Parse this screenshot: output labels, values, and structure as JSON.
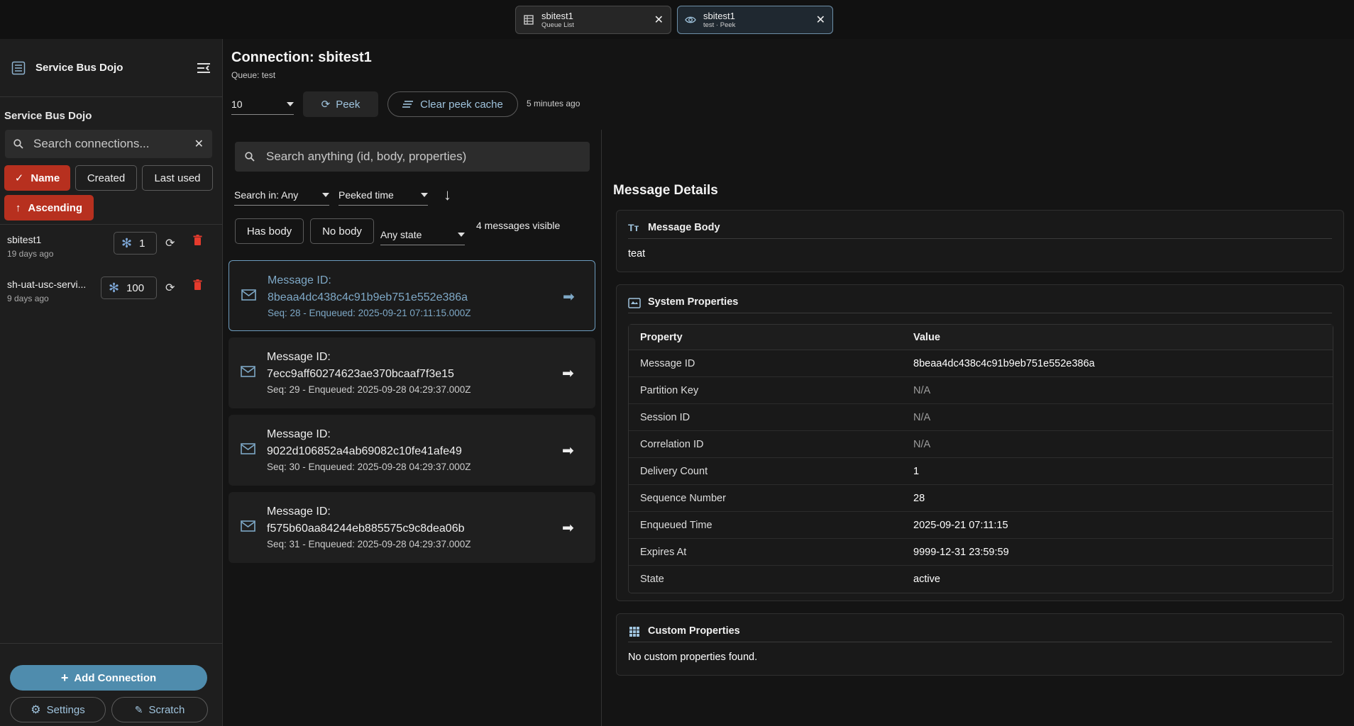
{
  "tabs": [
    {
      "name": "sbitest1",
      "sub": "Queue List",
      "icon": "table-icon",
      "active": false
    },
    {
      "name": "sbitest1",
      "sub": "test · Peek",
      "icon": "eye-icon",
      "active": true
    }
  ],
  "sidebar": {
    "brand": "Service Bus Dojo",
    "section_title": "Service Bus Dojo",
    "search_placeholder": "Search connections...",
    "sort_chips": {
      "name": "Name",
      "created": "Created",
      "last_used": "Last used",
      "order": "Ascending"
    },
    "connections": [
      {
        "name": "sbitest1",
        "sub": "19 days ago",
        "count": "1"
      },
      {
        "name": "sh-uat-usc-servi...",
        "sub": "9 days ago",
        "count": "100"
      }
    ],
    "footer": {
      "add": "Add Connection",
      "settings": "Settings",
      "scratch": "Scratch"
    }
  },
  "main": {
    "title": "Connection: sbitest1",
    "subtitle": "Queue: test",
    "peek_count": "10",
    "peek_label": "Peek",
    "clear_label": "Clear peek cache",
    "updated": "5 minutes ago",
    "search_placeholder": "Search anything (id, body, properties)",
    "search_in": "Search in: Any",
    "sort_by": "Peeked time",
    "filters": {
      "has_body": "Has body",
      "no_body": "No body",
      "state": "Any state"
    },
    "visible_count": "4 messages visible",
    "messages": [
      {
        "label": "Message ID:",
        "id": "8beaa4dc438c4c91b9eb751e552e386a",
        "meta": "Seq: 28 - Enqueued: 2025-09-21 07:11:15.000Z"
      },
      {
        "label": "Message ID:",
        "id": "7ecc9aff60274623ae370bcaaf7f3e15",
        "meta": "Seq: 29 - Enqueued: 2025-09-28 04:29:37.000Z"
      },
      {
        "label": "Message ID:",
        "id": "9022d106852a4ab69082c10fe41afe49",
        "meta": "Seq: 30 - Enqueued: 2025-09-28 04:29:37.000Z"
      },
      {
        "label": "Message ID:",
        "id": "f575b60aa84244eb885575c9c8dea06b",
        "meta": "Seq: 31 - Enqueued: 2025-09-28 04:29:37.000Z"
      }
    ]
  },
  "details": {
    "title": "Message Details",
    "body_title": "Message Body",
    "body": "teat",
    "sys_title": "System Properties",
    "col_property": "Property",
    "col_value": "Value",
    "props": [
      {
        "k": "Message ID",
        "v": "8beaa4dc438c4c91b9eb751e552e386a"
      },
      {
        "k": "Partition Key",
        "v": "N/A"
      },
      {
        "k": "Session ID",
        "v": "N/A"
      },
      {
        "k": "Correlation ID",
        "v": "N/A"
      },
      {
        "k": "Delivery Count",
        "v": "1"
      },
      {
        "k": "Sequence Number",
        "v": "28"
      },
      {
        "k": "Enqueued Time",
        "v": "2025-09-21 07:11:15"
      },
      {
        "k": "Expires At",
        "v": "9999-12-31 23:59:59"
      },
      {
        "k": "State",
        "v": "active"
      }
    ],
    "custom_title": "Custom Properties",
    "custom_empty": "No custom properties found."
  }
}
